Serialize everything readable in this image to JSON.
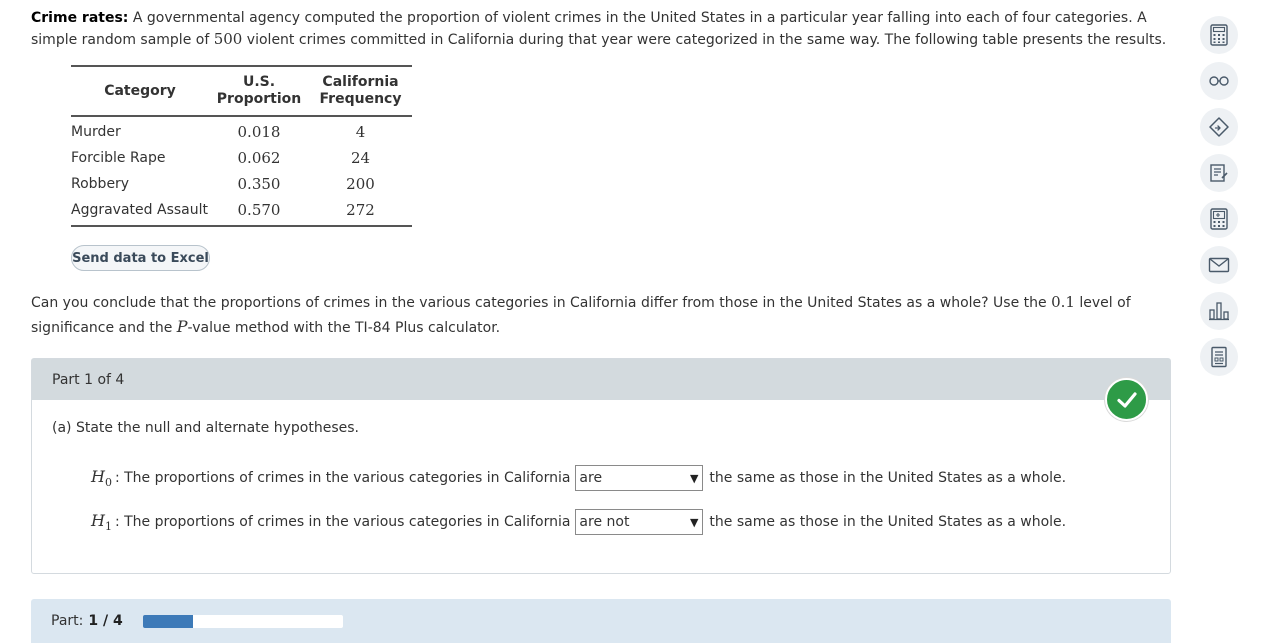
{
  "intro": {
    "title": "Crime rates:",
    "text_a": " A governmental agency computed the proportion of violent crimes in the United States in a particular year falling into each of four categories. A simple random sample of ",
    "sample_size": "500",
    "text_b": " violent crimes committed in California during that year were categorized in the same way. The following table presents the results."
  },
  "table": {
    "headers": {
      "category": "Category",
      "us_line1": "U.S.",
      "us_line2": "Proportion",
      "ca_line1": "California",
      "ca_line2": "Frequency"
    },
    "rows": [
      {
        "category": "Murder",
        "us": "0.018",
        "ca": "4"
      },
      {
        "category": "Forcible Rape",
        "us": "0.062",
        "ca": "24"
      },
      {
        "category": "Robbery",
        "us": "0.350",
        "ca": "200"
      },
      {
        "category": "Aggravated Assault",
        "us": "0.570",
        "ca": "272"
      }
    ]
  },
  "excel_button": "Send data to Excel",
  "question": {
    "text_a": "Can you conclude that the proportions of crimes in the various categories in California differ from those in the United States as a whole? Use the ",
    "level": "0.1",
    "text_b": " level of significance and the ",
    "p_symbol": "P",
    "text_c": "-value method with the TI-84 Plus calculator."
  },
  "part": {
    "header": "Part 1 of 4",
    "prompt": "(a) State the null and alternate hypotheses.",
    "h0": {
      "symbol": "H",
      "sub": "0",
      "prefix": ": The proportions of crimes in the various categories in California",
      "selected": "are",
      "suffix": "the same as those in the United States as a whole."
    },
    "h1": {
      "symbol": "H",
      "sub": "1",
      "prefix": ": The proportions of crimes in the various categories in California",
      "selected": "are not",
      "suffix": "the same as those in the United States as a whole."
    },
    "status_icon": "checkmark-icon",
    "status_color": "#2e9b47"
  },
  "progress": {
    "label": "Part:",
    "value": "1 / 4",
    "fraction": 0.25,
    "fill_color": "#3d7ab8"
  },
  "toolbar": {
    "icons": [
      "calculator-icon",
      "glasses-icon",
      "tag-icon",
      "notes-icon",
      "calculator-ti-icon",
      "mail-icon",
      "bar-chart-icon",
      "data-sheet-icon"
    ]
  }
}
